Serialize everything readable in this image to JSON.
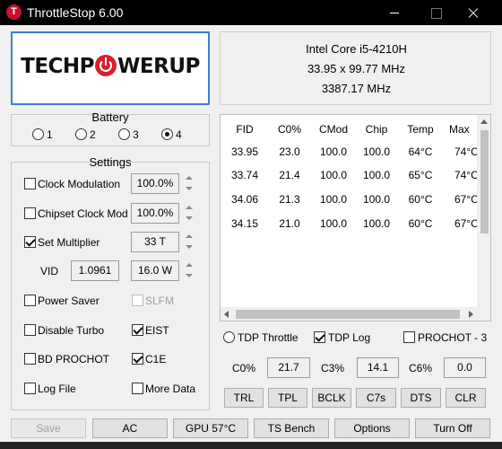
{
  "window": {
    "title": "ThrottleStop 6.00",
    "icon": "throttlestop-app-icon"
  },
  "logo": {
    "part1": "TECHP",
    "part2": "WERUP"
  },
  "cpu": {
    "name": "Intel Core i5-4210H",
    "multiplier": "33.95 x 99.77 MHz",
    "speed": "3387.17 MHz"
  },
  "profiles": {
    "title": "Battery",
    "options": [
      "1",
      "2",
      "3",
      "4"
    ],
    "selected": "4"
  },
  "settings": {
    "title": "Settings",
    "clock_modulation": {
      "label": "Clock Modulation",
      "value": "100.0%",
      "checked": false
    },
    "chipset_clock_mod": {
      "label": "Chipset Clock Mod",
      "value": "100.0%",
      "checked": false
    },
    "set_multiplier": {
      "label": "Set Multiplier",
      "value": "33 T",
      "checked": true
    },
    "vid": {
      "label": "VID",
      "value": "1.0961",
      "power": "16.0 W"
    },
    "power_saver": {
      "label": "Power Saver",
      "checked": false
    },
    "slfm": {
      "label": "SLFM",
      "checked": false,
      "disabled": true
    },
    "disable_turbo": {
      "label": "Disable Turbo",
      "checked": false
    },
    "eist": {
      "label": "EIST",
      "checked": true
    },
    "bd_prochot": {
      "label": "BD PROCHOT",
      "checked": false
    },
    "c1e": {
      "label": "C1E",
      "checked": true
    },
    "log_file": {
      "label": "Log File",
      "checked": false
    },
    "more_data": {
      "label": "More Data",
      "checked": false
    }
  },
  "table": {
    "columns": [
      "FID",
      "C0%",
      "CMod",
      "Chip",
      "Temp",
      "Max"
    ],
    "rows": [
      [
        "33.95",
        "23.0",
        "100.0",
        "100.0",
        "64°C",
        "74°C"
      ],
      [
        "33.74",
        "21.4",
        "100.0",
        "100.0",
        "65°C",
        "74°C"
      ],
      [
        "34.06",
        "21.3",
        "100.0",
        "100.0",
        "60°C",
        "67°C"
      ],
      [
        "34.15",
        "21.0",
        "100.0",
        "100.0",
        "60°C",
        "67°C"
      ]
    ]
  },
  "options": {
    "tdp_throttle": {
      "label": "TDP Throttle",
      "selected": false
    },
    "tdp_log": {
      "label": "TDP Log",
      "checked": true
    },
    "prochot": {
      "label": "PROCHOT - 3",
      "checked": false
    }
  },
  "cstates": [
    {
      "label": "C0%",
      "value": "21.7"
    },
    {
      "label": "C3%",
      "value": "14.1"
    },
    {
      "label": "C6%",
      "value": "0.0"
    }
  ],
  "tool_buttons": [
    "TRL",
    "TPL",
    "BCLK",
    "C7s",
    "DTS",
    "CLR"
  ],
  "bottom_buttons": [
    "Save",
    "AC",
    "GPU 57°C",
    "TS Bench",
    "Options",
    "Turn Off"
  ]
}
